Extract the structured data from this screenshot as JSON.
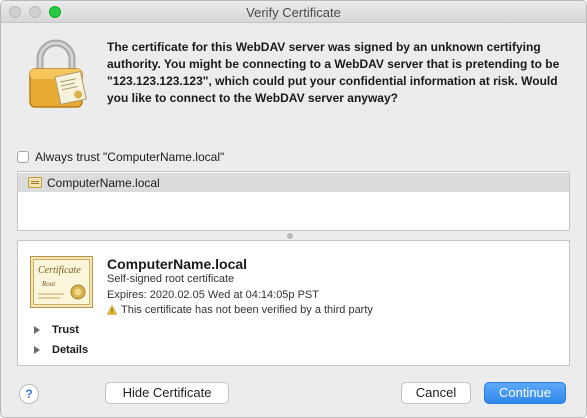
{
  "window": {
    "title": "Verify Certificate"
  },
  "message": {
    "text": "The certificate for this WebDAV server was signed by an unknown certifying authority. You might be connecting to a WebDAV server that is pretending to be \"123.123.123.123\", which could put your confidential information at risk. Would you like to connect to the WebDAV server anyway?"
  },
  "trust_checkbox": {
    "label": "Always trust \"ComputerName.local\"",
    "checked": false
  },
  "certificate_list": {
    "items": [
      {
        "label": "ComputerName.local",
        "selected": true
      }
    ]
  },
  "certificate_details": {
    "badge_title": "Certificate",
    "badge_subtitle": "Root",
    "name": "ComputerName.local",
    "type": "Self-signed root certificate",
    "expires": "Expires: 2020.02.05 Wed at 04:14:05p PST",
    "warning": "This certificate has not been verified by a third party",
    "sections": [
      {
        "label": "Trust",
        "expanded": false
      },
      {
        "label": "Details",
        "expanded": false
      }
    ]
  },
  "buttons": {
    "help": "?",
    "hide_certificate": "Hide Certificate",
    "cancel": "Cancel",
    "continue": "Continue"
  },
  "colors": {
    "accent": "#2f88ee",
    "zoom_button": "#28c840",
    "lock_gold": "#e8a935"
  },
  "icons": {
    "lock": "lock-icon",
    "certificate": "certificate-icon",
    "warning": "warning-icon",
    "help": "help-icon"
  }
}
